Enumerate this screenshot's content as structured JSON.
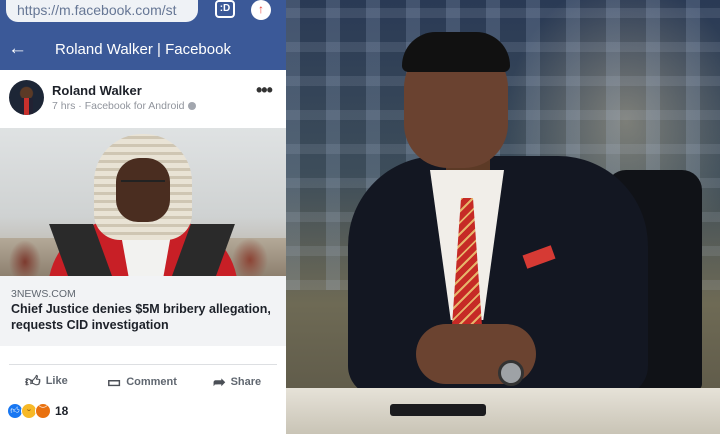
{
  "browser": {
    "url": "https://m.facebook.com/st",
    "tabs_label": ":D",
    "upload_icon": "arrow-up-icon"
  },
  "header": {
    "back_icon": "arrow-left-icon",
    "title": "Roland Walker | Facebook"
  },
  "post": {
    "author": "Roland Walker",
    "time": "7 hrs",
    "separator": " · ",
    "via": "Facebook for Android",
    "privacy_icon": "globe-icon",
    "more_icon": "•••"
  },
  "link": {
    "source": "3NEWS.COM",
    "headline": "Chief Justice denies $5M bribery allegation, requests CID investigation"
  },
  "actions": {
    "like": "Like",
    "comment": "Comment",
    "share": "Share"
  },
  "reactions": {
    "types": [
      "like",
      "haha",
      "angry"
    ],
    "count": "18"
  },
  "colors": {
    "facebook_blue": "#3b5998",
    "link_box_bg": "#f2f3f5"
  }
}
